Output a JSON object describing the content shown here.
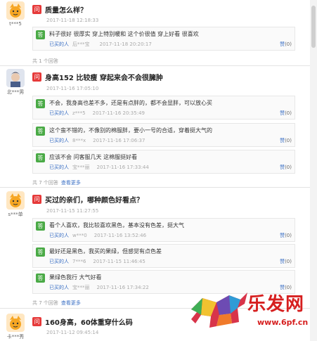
{
  "threads": [
    {
      "username": "t***5",
      "question": "质量怎么样？",
      "time": "2017-11-18 12:18:33",
      "answers": [
        {
          "text": "料子很好 很厚实 穿上特别暖和 这个价很值 穿上好看 很喜欢",
          "buyer_label": "已买的人",
          "user": "后***宝",
          "time": "2017-11-18 20:20:17",
          "like_label": "赞",
          "like_count": "(0)"
        }
      ],
      "footer_count": "共 1 个回答",
      "footer_more": ""
    },
    {
      "username": "北***男",
      "question": "身高152 比较瘦 穿起来会不会很臃肿",
      "time": "2017-11-16 17:05:10",
      "answers": [
        {
          "text": "不会，我身高也差不多，还是有点胖的，都不会显胖，可以放心买",
          "buyer_label": "已买的人",
          "user": "z***5",
          "time": "2017-11-16 20:35:49",
          "like_label": "赞",
          "like_count": "(0)"
        },
        {
          "text": "这个蛮不错的，不像别的棉服胖，要小一号的合适，穿着挺大气的",
          "buyer_label": "已买的人",
          "user": "8***x",
          "time": "2017-11-16 17:06:37",
          "like_label": "赞",
          "like_count": "(0)"
        },
        {
          "text": "应该不会 问客服几天 这棉服挺好看",
          "buyer_label": "已买的人",
          "user": "宝***丽",
          "time": "2017-11-16 17:33:44",
          "like_label": "赞",
          "like_count": "(0)"
        }
      ],
      "footer_count": "共 7 个回答",
      "footer_more": "查看更多"
    },
    {
      "username": "s***单",
      "question": "买过的亲们，哪种颜色好看点？",
      "time": "2017-11-15 11:27:55",
      "answers": [
        {
          "text": "看个人喜欢，我比较喜欢黑色，基本没有色差，挺大气",
          "buyer_label": "已买的人",
          "user": "w***0",
          "time": "2017-11-16 13:52:46",
          "like_label": "赞",
          "like_count": "(0)"
        },
        {
          "text": "最好还是黑色，我买的果绿，但感觉有点色差",
          "buyer_label": "已买的人",
          "user": "7***6",
          "time": "2017-11-15 11:46:45",
          "like_label": "赞",
          "like_count": "(0)"
        },
        {
          "text": "果绿色我行 大气好看",
          "buyer_label": "已买的人",
          "user": "宝***丽",
          "time": "2017-11-16 17:34:22",
          "like_label": "赞",
          "like_count": "(0)"
        }
      ],
      "footer_count": "共 7 个回答",
      "footer_more": "查看更多"
    },
    {
      "username": "卡***秀",
      "question": "160身高，60体重穿什么码",
      "time": "2017-11-12 09:45:14",
      "answers": [],
      "footer_count": "",
      "footer_more": ""
    }
  ],
  "tags": {
    "question": "问",
    "answer": "答"
  },
  "watermark": {
    "title": "乐发网",
    "url": "www.6pf.cn"
  },
  "colors": {
    "question_tag": "#e63a3a",
    "answer_tag": "#4aaa46",
    "link": "#3a6fc4",
    "watermark": "#d61f1f"
  }
}
